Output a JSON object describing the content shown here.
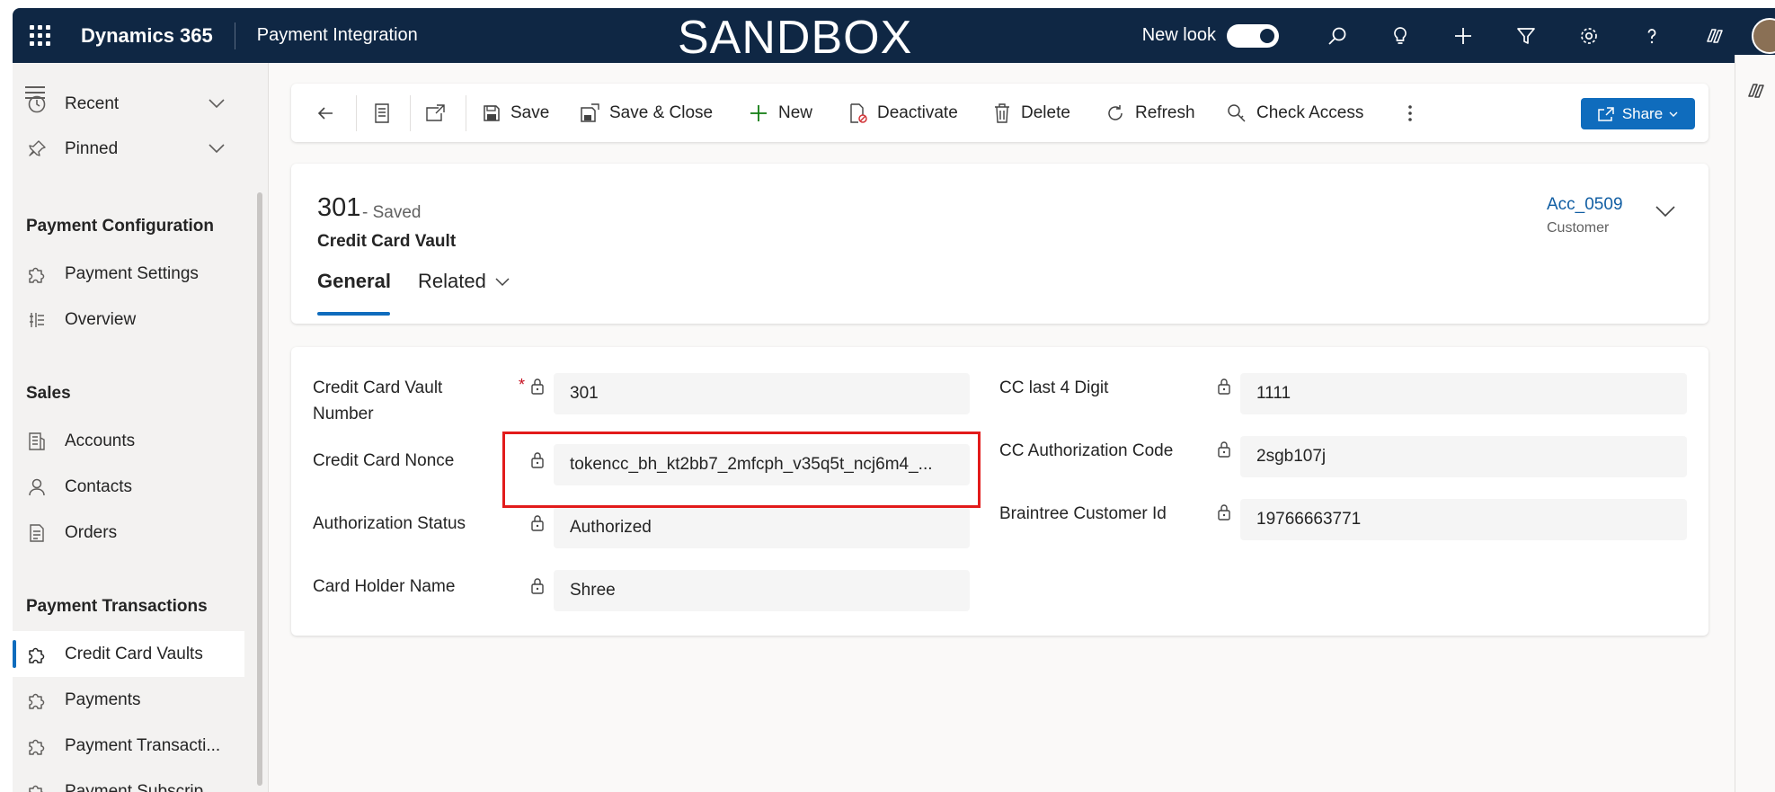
{
  "topbar": {
    "brand": "Dynamics 365",
    "app_name": "Payment Integration",
    "env_banner": "SANDBOX",
    "new_look_label": "New look",
    "new_look_on": true
  },
  "sidebar": {
    "recent": "Recent",
    "pinned": "Pinned",
    "groups": [
      {
        "title": "Payment Configuration",
        "items": [
          "Payment Settings",
          "Overview"
        ]
      },
      {
        "title": "Sales",
        "items": [
          "Accounts",
          "Contacts",
          "Orders"
        ]
      },
      {
        "title": "Payment Transactions",
        "items": [
          "Credit Card Vaults",
          "Payments",
          "Payment Transacti...",
          "Payment Subscrip..."
        ]
      }
    ],
    "active_item": "Credit Card Vaults"
  },
  "commands": {
    "save": "Save",
    "save_close": "Save & Close",
    "new": "New",
    "deactivate": "Deactivate",
    "delete": "Delete",
    "refresh": "Refresh",
    "check_access": "Check Access",
    "share": "Share"
  },
  "record": {
    "number": "301",
    "status": "- Saved",
    "entity": "Credit Card Vault",
    "owner_value": "Acc_0509",
    "owner_label": "Customer",
    "tabs": [
      "General",
      "Related"
    ]
  },
  "form": {
    "left": [
      {
        "label": "Credit Card Vault Number",
        "required": true,
        "value": "301"
      },
      {
        "label": "Credit Card Nonce",
        "required": false,
        "value": "tokencc_bh_kt2bb7_2mfcph_v35q5t_ncj6m4_..."
      },
      {
        "label": "Authorization Status",
        "required": false,
        "value": "Authorized"
      },
      {
        "label": "Card Holder Name",
        "required": false,
        "value": "Shree"
      }
    ],
    "right": [
      {
        "label": "CC last 4 Digit",
        "value": "1111"
      },
      {
        "label": "CC Authorization Code",
        "value": "2sgb107j"
      },
      {
        "label": "Braintree Customer Id",
        "value": "19766663771"
      }
    ]
  },
  "colors": {
    "topbar": "#0f2744",
    "accent": "#0f6cbd",
    "highlight": "#e21b1b"
  }
}
